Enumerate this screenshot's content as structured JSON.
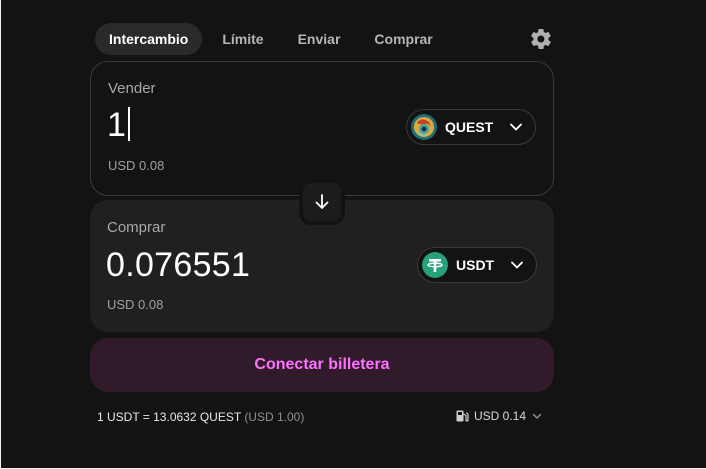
{
  "nav": {
    "tabs": [
      {
        "label": "Intercambio",
        "active": true
      },
      {
        "label": "Límite"
      },
      {
        "label": "Enviar"
      },
      {
        "label": "Comprar"
      }
    ],
    "settings_icon": "gear-icon"
  },
  "sell": {
    "label": "Vender",
    "amount": "1",
    "usd_value": "USD 0.08",
    "token": {
      "symbol": "QUEST",
      "icon": "quest-token-icon"
    }
  },
  "switch_icon": "arrow-down-icon",
  "buy": {
    "label": "Comprar",
    "amount": "0.076551",
    "usd_value": "USD 0.08",
    "token": {
      "symbol": "USDT",
      "icon": "tether-icon"
    }
  },
  "connect_button": "Conectar billetera",
  "footer": {
    "rate": "1 USDT = 13.0632 QUEST",
    "rate_usd": "(USD 1.00)",
    "gas": "USD 0.14",
    "gas_icon": "gas-pump-icon"
  },
  "colors": {
    "background": "#131313",
    "panel": "#202020",
    "accent": "#fc72ff",
    "connect_bg": "#311a29",
    "tether": "#26a17b"
  }
}
